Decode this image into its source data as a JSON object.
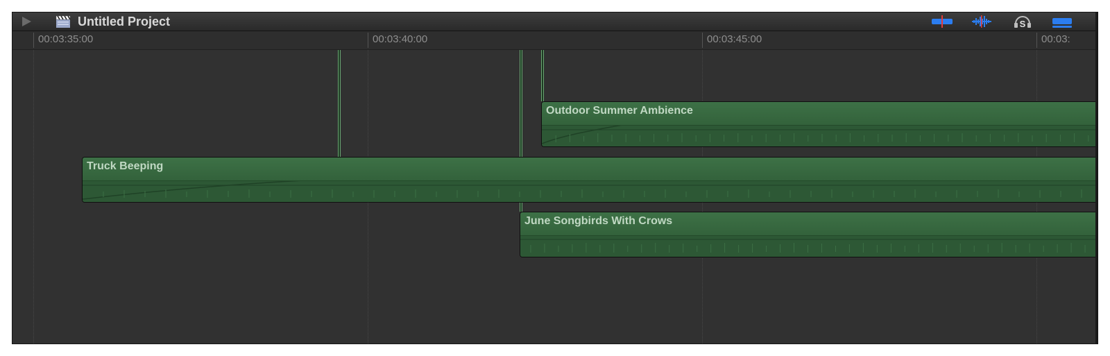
{
  "window": {
    "title": "Untitled Project"
  },
  "toolbar": {
    "play": "play-icon",
    "project_icon": "clapperboard-icon",
    "skimming": "skimming-icon",
    "audio_skimming": "audio-skimming-icon",
    "solo": "solo-icon",
    "snapping": "snapping-icon"
  },
  "ruler": {
    "ticks": [
      "00:03:35:00",
      "00:03:40:00",
      "00:03:45:00",
      "00:03:"
    ]
  },
  "timeline": {
    "clips": [
      {
        "name": "Outdoor Summer Ambience"
      },
      {
        "name": "Truck Beeping"
      },
      {
        "name": "June Songbirds With Crows"
      }
    ]
  },
  "colors": {
    "clip_green": "#2f5c37",
    "clip_header": "#3d7146",
    "accent_blue": "#2b7df0",
    "background": "#313131"
  }
}
